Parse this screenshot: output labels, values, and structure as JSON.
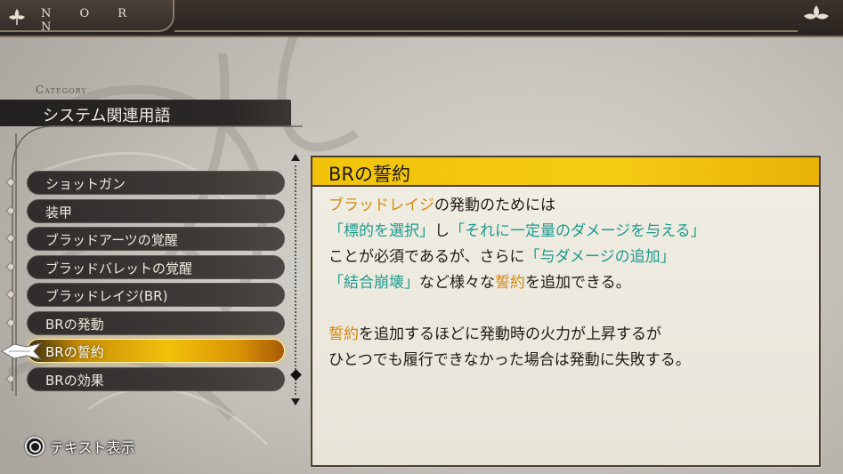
{
  "header": {
    "brand": "N O R N"
  },
  "category": {
    "label": "Category",
    "value": "システム関連用語"
  },
  "list": {
    "items": [
      {
        "label": "ショットガン",
        "selected": false
      },
      {
        "label": "装甲",
        "selected": false
      },
      {
        "label": "ブラッドアーツの覚醒",
        "selected": false
      },
      {
        "label": "ブラッドバレットの覚醒",
        "selected": false
      },
      {
        "label": "ブラッドレイジ(BR)",
        "selected": false
      },
      {
        "label": "BRの発動",
        "selected": false
      },
      {
        "label": "BRの誓約",
        "selected": true
      },
      {
        "label": "BRの効果",
        "selected": false
      }
    ]
  },
  "detail": {
    "title": "BRの誓約",
    "lines": [
      [
        {
          "text": "ブラッドレイジ",
          "color": "orange"
        },
        {
          "text": "の発動のためには",
          "color": "default"
        }
      ],
      [
        {
          "text": "「標的を選択」",
          "color": "teal"
        },
        {
          "text": "し",
          "color": "default"
        },
        {
          "text": "「それに一定量のダメージを与える」",
          "color": "teal"
        }
      ],
      [
        {
          "text": "ことが必須であるが、さらに",
          "color": "default"
        },
        {
          "text": "「与ダメージの追加」",
          "color": "teal"
        }
      ],
      [
        {
          "text": "「結合崩壊」",
          "color": "teal"
        },
        {
          "text": "など様々な",
          "color": "default"
        },
        {
          "text": "誓約",
          "color": "orange"
        },
        {
          "text": "を追加できる。",
          "color": "default"
        }
      ],
      [],
      [
        {
          "text": "誓約",
          "color": "orange"
        },
        {
          "text": "を追加するほどに発動時の火力が上昇するが",
          "color": "default"
        }
      ],
      [
        {
          "text": "ひとつでも履行できなかった場合は発動に失敗する。",
          "color": "default"
        }
      ]
    ]
  },
  "footer": {
    "button_icon": "circle-button-icon",
    "label": "テキスト表示"
  },
  "colors": {
    "accent_yellow": "#f2c30b",
    "highlight_orange": "#d58a12",
    "highlight_teal": "#1e9a8e",
    "dark_panel": "#2b2827"
  }
}
